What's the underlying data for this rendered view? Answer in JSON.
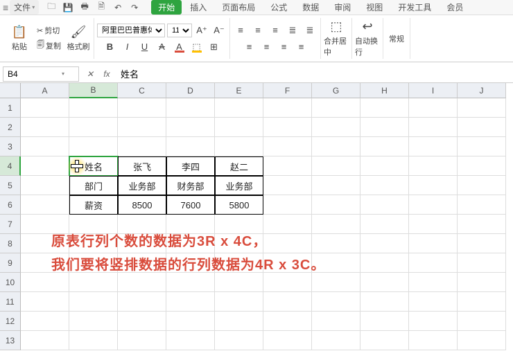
{
  "menubar": {
    "file": "文件"
  },
  "tabs": [
    "开始",
    "插入",
    "页面布局",
    "公式",
    "数据",
    "审阅",
    "视图",
    "开发工具",
    "会员"
  ],
  "active_tab": 0,
  "ribbon": {
    "paste": "粘贴",
    "format_painter": "格式刷",
    "cut": "剪切",
    "copy": "复制",
    "font_name": "阿里巴巴普惠体",
    "font_size": "11",
    "merge": "合并居中",
    "wrap": "自动换行",
    "normal": "常规"
  },
  "name_box": "B4",
  "formula_value": "姓名",
  "cols": [
    "A",
    "B",
    "C",
    "D",
    "E",
    "F",
    "G",
    "H",
    "I",
    "J"
  ],
  "rows": [
    "1",
    "2",
    "3",
    "4",
    "5",
    "6",
    "7",
    "8",
    "9",
    "10",
    "11",
    "12",
    "13"
  ],
  "selected_col": 1,
  "selected_row": 3,
  "table": {
    "r0": [
      "姓名",
      "张飞",
      "李四",
      "赵二"
    ],
    "r1": [
      "部门",
      "业务部",
      "财务部",
      "业务部"
    ],
    "r2": [
      "薪资",
      "8500",
      "7600",
      "5800"
    ]
  },
  "annotation": {
    "line1": "原表行列个数的数据为3R x 4C，",
    "line2": "我们要将竖排数据的行列数据为4R x 3C。"
  }
}
